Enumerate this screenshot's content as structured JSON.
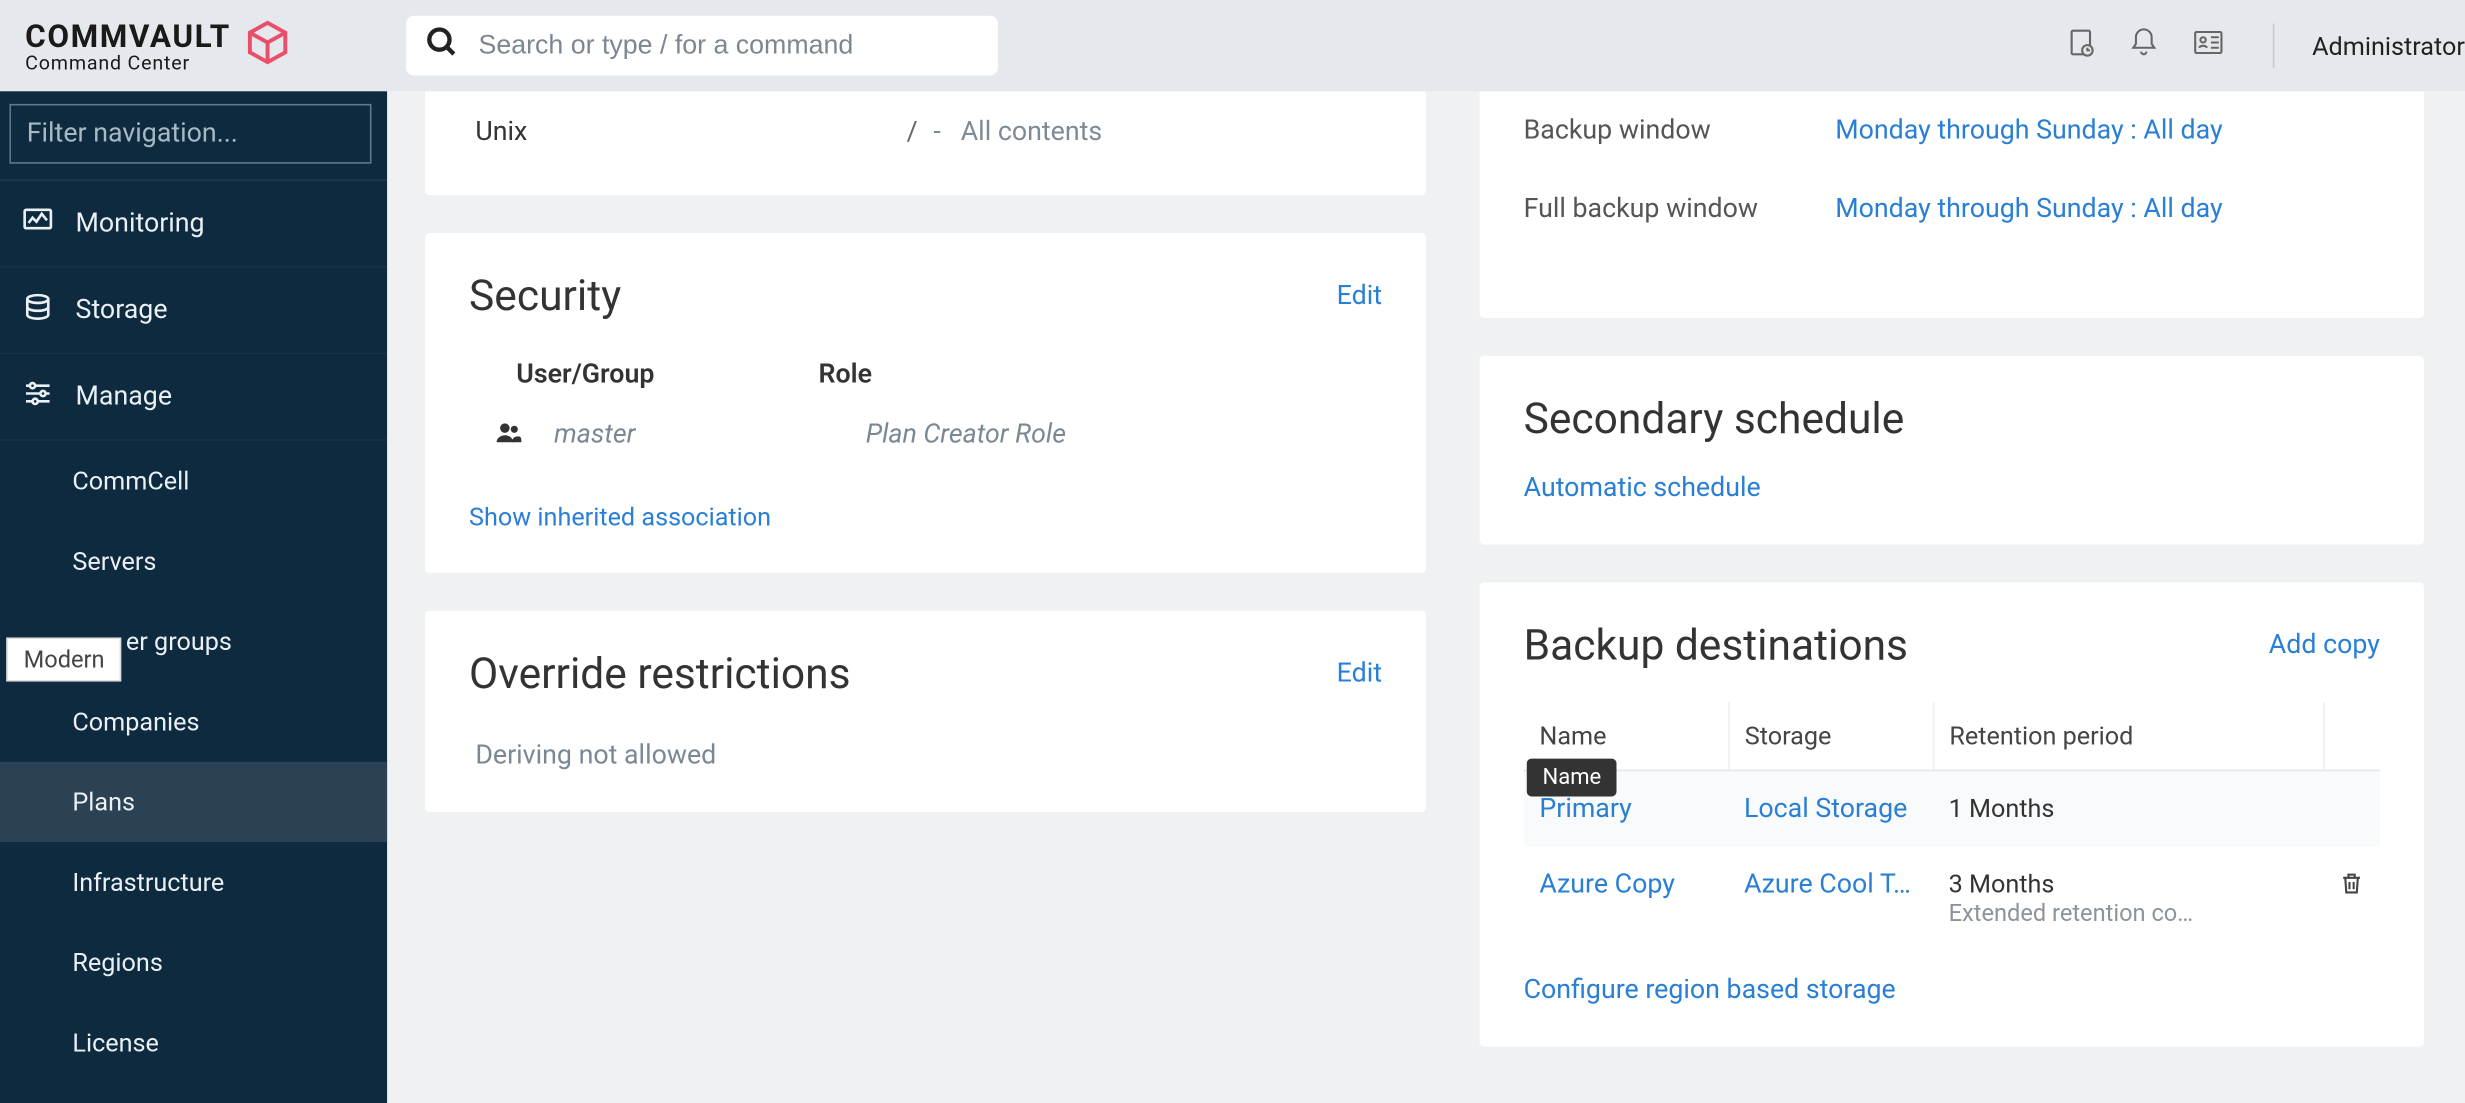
{
  "header": {
    "brand_top": "COMMVAULT",
    "brand_sub": "Command Center",
    "search_placeholder": "Search or type / for a command",
    "user_label": "Administrator"
  },
  "sidebar": {
    "filter_placeholder": "Filter navigation...",
    "top_items": [
      {
        "label": "Monitoring",
        "icon": "monitor-icon"
      },
      {
        "label": "Storage",
        "icon": "storage-icon"
      },
      {
        "label": "Manage",
        "icon": "sliders-icon"
      }
    ],
    "sub_items": [
      {
        "label": "CommCell"
      },
      {
        "label": "Servers"
      },
      {
        "label": "er groups"
      },
      {
        "label": "Companies"
      },
      {
        "label": "Plans",
        "active": true
      },
      {
        "label": "Infrastructure"
      },
      {
        "label": "Regions"
      },
      {
        "label": "License"
      }
    ],
    "chip": "Modern"
  },
  "left_cards": {
    "content_row": {
      "os": "Unix",
      "separator": "/",
      "value_prefix": "-",
      "value": "All contents"
    },
    "security": {
      "title": "Security",
      "edit": "Edit",
      "col_user": "User/Group",
      "col_role": "Role",
      "user_value": "master",
      "role_value": "Plan Creator Role",
      "show_inherited": "Show inherited association"
    },
    "override": {
      "title": "Override restrictions",
      "edit": "Edit",
      "body": "Deriving not allowed"
    }
  },
  "right_cards": {
    "rpo": {
      "backup_window_label": "Backup window",
      "backup_window_value": "Monday through Sunday : All day",
      "full_window_label": "Full backup window",
      "full_window_value": "Monday through Sunday : All day"
    },
    "secondary": {
      "title": "Secondary schedule",
      "link": "Automatic schedule"
    },
    "destinations": {
      "title": "Backup destinations",
      "add_copy": "Add copy",
      "cols": {
        "name": "Name",
        "storage": "Storage",
        "retention": "Retention period"
      },
      "name_tooltip": "Name",
      "rows": [
        {
          "name": "Primary",
          "storage": "Local Storage",
          "retention": "1 Months",
          "retention_sub": "",
          "deletable": false
        },
        {
          "name": "Azure Copy",
          "storage": "Azure Cool T…",
          "retention": "3 Months",
          "retention_sub": "Extended retention co…",
          "deletable": true
        }
      ],
      "configure_region": "Configure region based storage"
    }
  }
}
